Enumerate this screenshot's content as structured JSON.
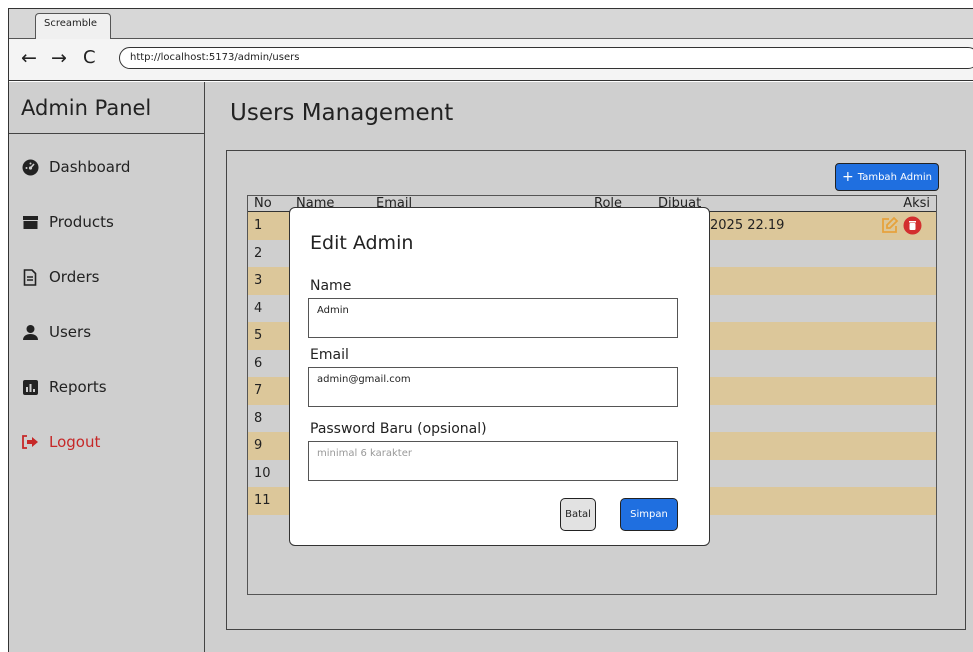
{
  "browser": {
    "tab_title": "Screamble",
    "url": "http://localhost:5173/admin/users"
  },
  "sidebar": {
    "title": "Admin Panel",
    "items": [
      {
        "label": "Dashboard",
        "icon": "dashboard-icon"
      },
      {
        "label": "Products",
        "icon": "products-icon"
      },
      {
        "label": "Orders",
        "icon": "orders-icon"
      },
      {
        "label": "Users",
        "icon": "users-icon"
      },
      {
        "label": "Reports",
        "icon": "reports-icon"
      },
      {
        "label": "Logout",
        "icon": "logout-icon"
      }
    ]
  },
  "main": {
    "title": "Users Management",
    "add_button": "Tambah Admin",
    "table": {
      "headers": [
        "No",
        "Name",
        "Email",
        "Role",
        "Dibuat",
        "Aksi"
      ],
      "rows": [
        {
          "no": "1",
          "dibuat": "2025 22.19"
        },
        {
          "no": "2"
        },
        {
          "no": "3"
        },
        {
          "no": "4"
        },
        {
          "no": "5"
        },
        {
          "no": "6"
        },
        {
          "no": "7"
        },
        {
          "no": "8"
        },
        {
          "no": "9"
        },
        {
          "no": "10"
        },
        {
          "no": "11"
        }
      ]
    }
  },
  "modal": {
    "title": "Edit Admin",
    "name_label": "Name",
    "name_value": "Admin",
    "email_label": "Email",
    "email_value": "admin@gmail.com",
    "password_label": "Password Baru (opsional)",
    "password_placeholder": "minimal 6 karakter",
    "cancel_label": "Batal",
    "save_label": "Simpan"
  },
  "colors": {
    "accent": "#1f6fe0",
    "row_alt": "#dcc79a",
    "logout": "#c62828",
    "edit_icon": "#e6a23c",
    "delete_icon": "#d32f2f"
  }
}
